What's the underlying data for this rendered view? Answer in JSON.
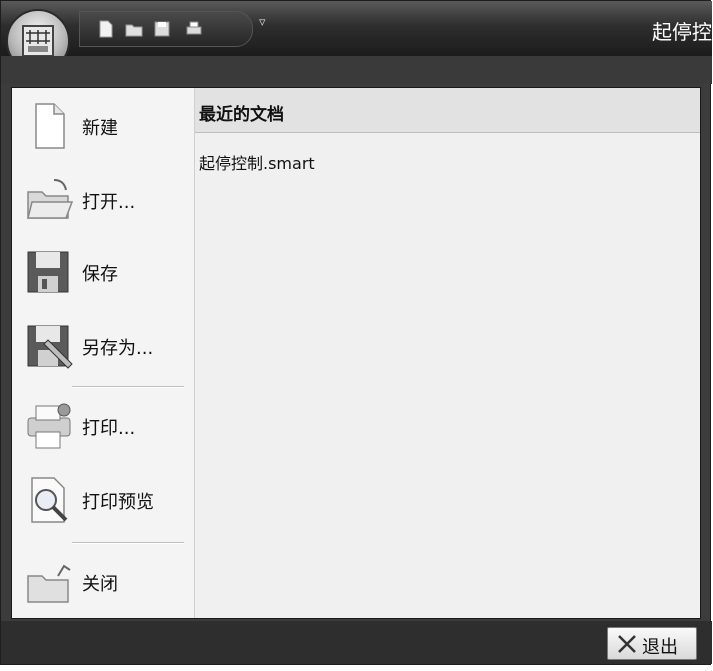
{
  "window": {
    "title": "起停控"
  },
  "menu": {
    "items": [
      {
        "label": "新建",
        "icon": "new-document-icon"
      },
      {
        "label": "打开...",
        "icon": "open-folder-icon"
      },
      {
        "label": "保存",
        "icon": "save-disk-icon"
      },
      {
        "label": "另存为...",
        "icon": "save-as-icon"
      },
      {
        "label": "打印...",
        "icon": "printer-icon"
      },
      {
        "label": "打印预览",
        "icon": "print-preview-icon"
      },
      {
        "label": "关闭",
        "icon": "close-folder-icon"
      }
    ]
  },
  "recent": {
    "header": "最近的文档",
    "items": [
      "起停控制.smart"
    ]
  },
  "footer": {
    "exit_label": "退出"
  }
}
